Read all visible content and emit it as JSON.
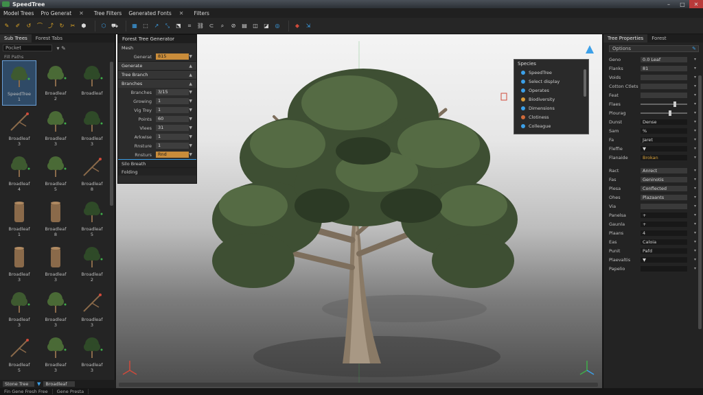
{
  "window": {
    "title": "SpeedTree"
  },
  "menu": {
    "items": [
      "Model Trees",
      "Pro Generat",
      "Tree Filters",
      "Generated Fonts",
      "Filters"
    ]
  },
  "left_panel": {
    "tabs": [
      "Sub Trees",
      "Forest Tabs"
    ],
    "search_value": "Pocket",
    "subheader": "Fill Paths",
    "assets": [
      {
        "label": "SpeedTree\n1"
      },
      {
        "label": "Broadleaf\n2"
      },
      {
        "label": "Broadleaf"
      },
      {
        "label": "Broadleaf\n3"
      },
      {
        "label": "Broadleaf\n3"
      },
      {
        "label": "Broadleaf\n3"
      },
      {
        "label": "Broadleaf\n4"
      },
      {
        "label": "Broadleaf\n5"
      },
      {
        "label": "Broadleaf\n8"
      },
      {
        "label": "Broadleaf\n1"
      },
      {
        "label": "Broadleaf\n8"
      },
      {
        "label": "Broadleaf\n5"
      },
      {
        "label": "Broadleaf\n3"
      },
      {
        "label": "Broadleaf\n3"
      },
      {
        "label": "Broadleaf\n2"
      },
      {
        "label": "Broadleaf\n3"
      },
      {
        "label": "Broadleaf\n3"
      },
      {
        "label": "Broadleaf\n3"
      },
      {
        "label": "Broadleaf\n5"
      },
      {
        "label": "Broadleaf\n3"
      },
      {
        "label": "Broadleaf\n3"
      }
    ],
    "bottom_field": "Stone Tree",
    "bottom_field2": "Broadleaf"
  },
  "props_float": {
    "header": "Forest Tree Generator",
    "rows": [
      {
        "type": "row",
        "label": "Mesh"
      },
      {
        "type": "hl",
        "label": "Generat",
        "value": "815"
      },
      {
        "type": "section",
        "label": "Generate"
      },
      {
        "type": "section",
        "label": "Tree Branch"
      },
      {
        "type": "section",
        "label": "Branches"
      },
      {
        "type": "field",
        "label": "Branches",
        "value": "3/15"
      },
      {
        "type": "field",
        "label": "Growing",
        "value": "1"
      },
      {
        "type": "field",
        "label": "Vig Trey",
        "value": "1"
      },
      {
        "type": "field",
        "label": "Points",
        "value": "60"
      },
      {
        "type": "field",
        "label": "Vlees",
        "value": "31"
      },
      {
        "type": "field",
        "label": "Arkwise",
        "value": "1"
      },
      {
        "type": "field",
        "label": "Rnsture",
        "value": "1"
      },
      {
        "type": "orange",
        "label": "Rnsturs",
        "value": "Rnd"
      }
    ],
    "footer1": "Silo Breath",
    "footer2": "Folding"
  },
  "species": {
    "header": "Species",
    "items": [
      {
        "label": "SpeedTree",
        "color": "#3ca0e8"
      },
      {
        "label": "Select display",
        "color": "#3ca0e8"
      },
      {
        "label": "Operates",
        "color": "#3ca0e8"
      },
      {
        "label": "Biodiversity",
        "color": "#d89a3a"
      },
      {
        "label": "Dimensions",
        "color": "#3ca0e8"
      },
      {
        "label": "Clotiness",
        "color": "#d06a3a"
      },
      {
        "label": "Colleague",
        "color": "#3ca0e8"
      }
    ]
  },
  "right_panel": {
    "tabs": [
      "Tree Properties",
      "Forest"
    ],
    "search": "Options",
    "rows": [
      {
        "label": "Geno",
        "value": "0.0 Leaf",
        "kind": "field"
      },
      {
        "label": "Flanks",
        "value": "81",
        "kind": "field"
      },
      {
        "label": "Voids",
        "value": "",
        "kind": "field"
      },
      {
        "label": "Cotton Ctlets",
        "value": "",
        "kind": "field"
      },
      {
        "label": "Feat",
        "value": "",
        "kind": "field"
      },
      {
        "label": "Flaes",
        "value": "",
        "kind": "slider",
        "pos": 0.7
      },
      {
        "label": "Plourag",
        "value": "",
        "kind": "slider",
        "pos": 0.6
      },
      {
        "label": "Dunst",
        "value": "Dense",
        "kind": "dark"
      },
      {
        "label": "Sam",
        "value": "%",
        "kind": "dark"
      },
      {
        "label": "Fa",
        "value": "Jaret",
        "kind": "dark"
      },
      {
        "label": "Fleffie",
        "value": "▼",
        "kind": "dark"
      },
      {
        "label": "Flanaide",
        "value": "Brokan",
        "kind": "orange"
      },
      {
        "label": "",
        "value": "",
        "kind": "spacer"
      },
      {
        "label": "Ract",
        "value": "Anrect",
        "kind": "field"
      },
      {
        "label": "Fas",
        "value": "Geninotis",
        "kind": "field"
      },
      {
        "label": "Plesa",
        "value": "Conflected",
        "kind": "field"
      },
      {
        "label": "Ohes",
        "value": "Plazaants",
        "kind": "field"
      },
      {
        "label": "Via",
        "value": "",
        "kind": "field"
      },
      {
        "label": "Panelsa",
        "value": "+",
        "kind": "dark"
      },
      {
        "label": "Gaunla",
        "value": "+",
        "kind": "dark"
      },
      {
        "label": "Plaans",
        "value": "4",
        "kind": "dark"
      },
      {
        "label": "Eas",
        "value": "Caloia",
        "kind": "dark"
      },
      {
        "label": "Punit",
        "value": "Pafd",
        "kind": "dark"
      },
      {
        "label": "Plaevaltis",
        "value": "▼",
        "kind": "dark"
      },
      {
        "label": "Papelio",
        "value": "",
        "kind": "dark"
      }
    ]
  },
  "status": {
    "items": [
      "Fin Gene Fresh Free",
      "Gene Presta"
    ]
  }
}
